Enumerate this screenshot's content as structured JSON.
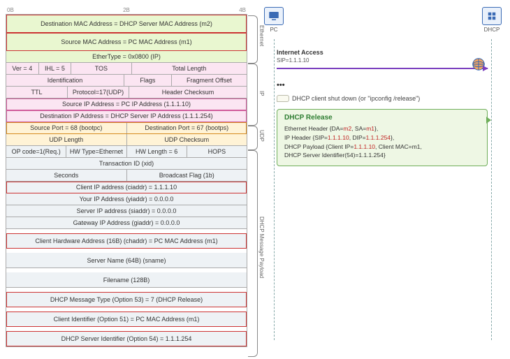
{
  "scale": {
    "b0": "0B",
    "b2": "2B",
    "b4": "4B"
  },
  "sections": {
    "eth": "Ethernet",
    "ip": "IP",
    "udp": "UDP",
    "dhcp": "DHCP Message Payload"
  },
  "eth": {
    "dst": "Destination MAC Address = DHCP Server MAC Address (m2)",
    "src": "Source MAC Address = PC MAC Address (m1)",
    "type": "EtherType = 0x0800 (IP)"
  },
  "ip": {
    "ver": "Ver = 4",
    "ihl": "IHL = 5",
    "tos": "TOS",
    "tlen": "Total Length",
    "id": "Identification",
    "flags": "Flags",
    "frag": "Fragment Offset",
    "ttl": "TTL",
    "proto": "Protocol=17(UDP)",
    "chk": "Header Checksum",
    "src": "Source IP Address = PC IP Address (1.1.1.10)",
    "dst": "Destination IP Address = DHCP Server IP Address (1.1.1.254)"
  },
  "udp": {
    "sport": "Source Port = 68 (bootpc)",
    "dport": "Destination Port = 67 (bootps)",
    "len": "UDP Length",
    "chk": "UDP Checksum"
  },
  "dhcp": {
    "op": "OP code=1(Req.)",
    "hwt": "HW Type=Ethernet",
    "hwl": "HW Length = 6",
    "hops": "HOPS",
    "xid": "Transaction ID (xid)",
    "secs": "Seconds",
    "bflag": "Broadcast Flag (1b)",
    "ciaddr": "Client IP address (ciaddr) = 1.1.1.10",
    "yiaddr": "Your IP Address (yiaddr) = 0.0.0.0",
    "siaddr": "Server IP address (siaddr) = 0.0.0.0",
    "giaddr": "Gateway IP Address (giaddr) = 0.0.0.0",
    "chaddr": "Client Hardware Address (16B) (chaddr) = PC MAC Address (m1)",
    "sname": "Server Name (64B) (sname)",
    "file": "Filename (128B)",
    "opt53": "DHCP Message Type (Option 53) = 7 (DHCP Release)",
    "opt51": "Client Identifier (Option 51) = PC MAC Address (m1)",
    "opt54": "DHCP Server Identifier (Option 54) = 1.1.1.254"
  },
  "seq": {
    "pc": "PC",
    "dhcp_node": "DHCP",
    "internet": "Internet Access",
    "sip": "SIP=1.1.1.10",
    "dots": "•••",
    "note": "DHCP client shut down (or \"ipconfig /release\")",
    "release_title": "DHCP Release",
    "l1a": "Ethernet Header {DA=",
    "l1b": "m2",
    "l1c": ", SA=",
    "l1d": "m1",
    "l1e": "},",
    "l2a": "IP Header {SIP=",
    "l2b": "1.1.1.10",
    "l2c": ", DIP=",
    "l2d": "1.1.1.254",
    "l2e": "},",
    "l3a": "DHCP Payload {Client IP=",
    "l3b": "1.1.1.10",
    "l3c": ", Client MAC=m1,",
    "l4": "DHCP Server Identifier(54)=1.1.1.254}"
  }
}
